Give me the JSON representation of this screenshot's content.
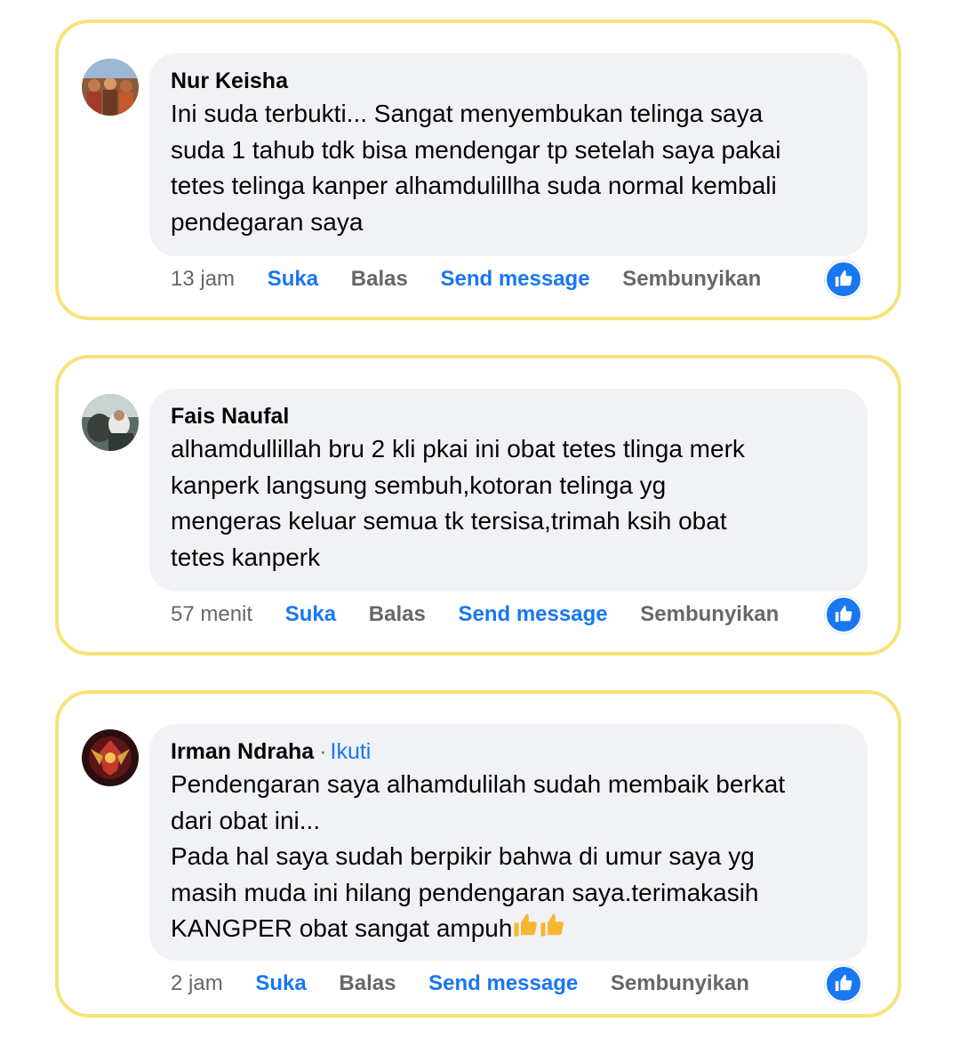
{
  "comments": [
    {
      "author": "Nur Keisha",
      "follow": "",
      "text": "Ini suda terbukti... Sangat menyembukan telinga saya\nsuda 1 tahub tdk bisa mendengar tp setelah saya pakai\ntetes telinga kanper alhamdulillha suda normal kembali\npendegaran saya",
      "time": "13 jam",
      "like": "Suka",
      "reply": "Balas",
      "send": "Send message",
      "hide": "Sembunyikan",
      "reaction_icon": "thumbs-up-icon"
    },
    {
      "author": "Fais Naufal",
      "follow": "",
      "text": "alhamdullillah bru 2 kli pkai ini obat tetes tlinga merk\nkanperk langsung sembuh,kotoran telinga yg\nmengeras keluar semua tk tersisa,trimah ksih obat\ntetes kanperk",
      "time": "57 menit",
      "like": "Suka",
      "reply": "Balas",
      "send": "Send message",
      "hide": "Sembunyikan",
      "reaction_icon": "thumbs-up-icon"
    },
    {
      "author": "Irman Ndraha",
      "separator": "·",
      "follow": "Ikuti",
      "text": "Pendengaran saya alhamdulilah sudah membaik berkat\ndari obat ini...\nPada hal saya sudah berpikir bahwa di umur saya yg\nmasih muda ini hilang pendengaran saya.terimakasih\nKANGPER obat sangat ampuh",
      "emoji": "👍👍",
      "time": "2 jam",
      "like": "Suka",
      "reply": "Balas",
      "send": "Send message",
      "hide": "Sembunyikan",
      "reaction_icon": "thumbs-up-icon"
    }
  ],
  "colors": {
    "card_border": "#f7e27a",
    "bubble_bg": "#f0f2f5",
    "accent_blue": "#1877f2",
    "muted_text": "#65676b",
    "emoji_yellow": "#f8b630"
  }
}
